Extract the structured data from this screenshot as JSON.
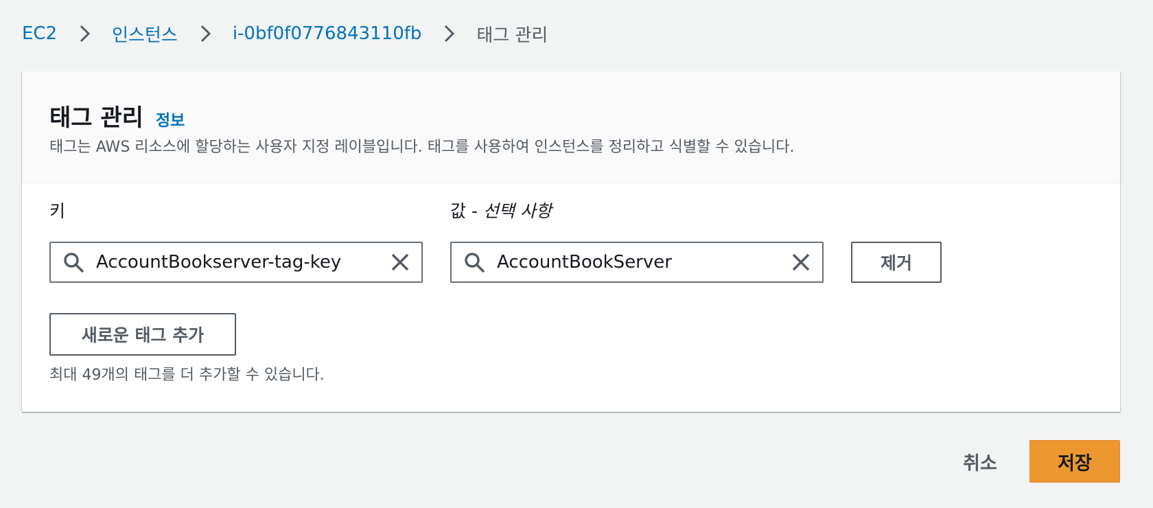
{
  "breadcrumb": {
    "items": [
      {
        "label": "EC2"
      },
      {
        "label": "인스턴스"
      },
      {
        "label": "i-0bf0f0776843110fb"
      },
      {
        "label": "태그 관리"
      }
    ]
  },
  "panel": {
    "title": "태그 관리",
    "info_link": "정보",
    "description": "태그는 AWS 리소스에 할당하는 사용자 지정 레이블입니다. 태그를 사용하여 인스턴스를 정리하고 식별할 수 있습니다."
  },
  "tag_editor": {
    "key_label": "키",
    "value_label": "값 -",
    "value_label_optional": "선택 사항",
    "rows": [
      {
        "key": "AccountBookserver-tag-key",
        "value": "AccountBookServer",
        "remove_label": "제거"
      }
    ],
    "add_button_label": "새로운 태그 추가",
    "limit_hint": "최대 49개의 태그를 더 추가할 수 있습니다."
  },
  "footer": {
    "cancel_label": "취소",
    "save_label": "저장"
  },
  "icons": {
    "separator": "chevron-right-icon",
    "search": "search-icon",
    "clear": "close-icon"
  },
  "colors": {
    "link": "#0073bb",
    "primary_button": "#ec972f",
    "background": "#f2f3f3"
  }
}
